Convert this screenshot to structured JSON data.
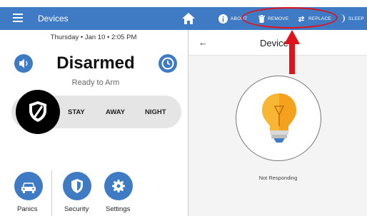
{
  "topbar": {
    "title": "Devices",
    "actions": {
      "about": "ABOUT",
      "remove": "REMOVE",
      "replace": "REPLACE",
      "sleep": "SLEEP"
    }
  },
  "left": {
    "date_line": "Thursday  •  Jan 10  •  2:05 PM",
    "status": "Disarmed",
    "status_sub": "Ready to Arm",
    "arm_options": [
      "STAY",
      "AWAY",
      "NIGHT"
    ],
    "bottom": [
      "Panics",
      "Security",
      "Settings"
    ]
  },
  "right": {
    "title": "Device",
    "device_status": "Not Responding"
  },
  "colors": {
    "accent": "#3f7bc4",
    "annotation": "#e0131a",
    "bulb_yellow": "#f7b734",
    "bulb_base": "#3f7bc4"
  },
  "icons": {
    "menu": "hamburger-icon",
    "home": "home-icon",
    "about": "info-icon",
    "remove": "trash-icon",
    "replace": "replace-icon",
    "sleep": "moon-icon",
    "speaker": "speaker-icon",
    "clock": "clock-icon",
    "shield": "shield-icon",
    "panics": "car-icon",
    "security": "shield-icon",
    "settings": "gear-icon",
    "device": "lightbulb-icon",
    "back": "arrow-left-icon"
  }
}
